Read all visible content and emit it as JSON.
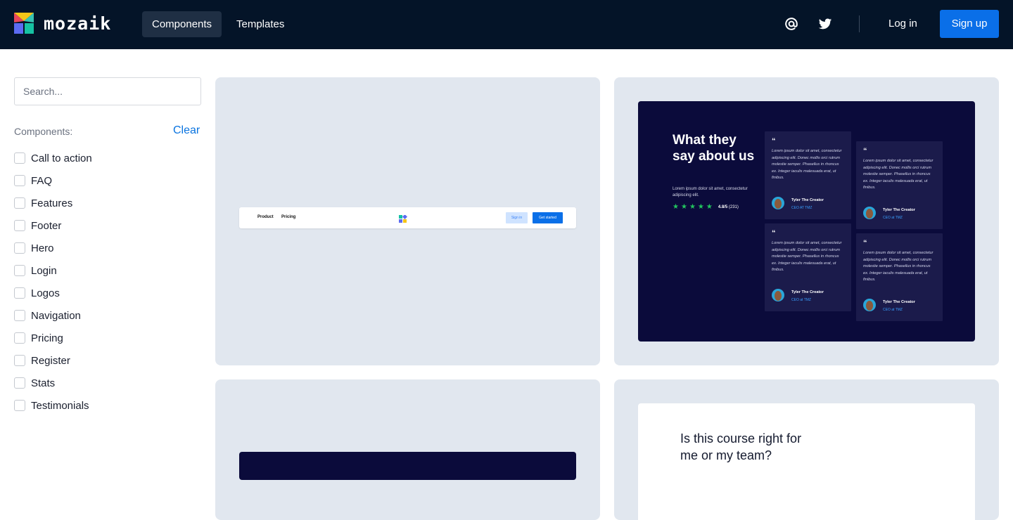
{
  "header": {
    "brand": "mozaik",
    "nav": [
      "Components",
      "Templates"
    ],
    "login": "Log in",
    "signup": "Sign up",
    "icons": [
      "at-icon",
      "twitter-icon"
    ]
  },
  "sidebar": {
    "search_placeholder": "Search...",
    "title": "Components:",
    "clear": "Clear",
    "items": [
      "Call to action",
      "FAQ",
      "Features",
      "Footer",
      "Hero",
      "Login",
      "Logos",
      "Navigation",
      "Pricing",
      "Register",
      "Stats",
      "Testimonials"
    ]
  },
  "cards": {
    "nav_preview": {
      "links": [
        "Product",
        "Pricing"
      ],
      "sign_in": "Sign in",
      "get_started": "Get started"
    },
    "testimonials_preview": {
      "title": "What they say about us",
      "subtitle": "Lorem ipsum dolor sit amet, consectetur adipiscing elit.",
      "rating_value": "4.8/5",
      "rating_count": "(231)",
      "quote_mark": "“",
      "quote": "Lorem ipsum dolor sit amet, consectetur adipiscing elit. Donec mollis orci rutrum molestie semper. Phasellus in rhoncus ex. Integer iaculis malesuada erat, ut finibus.",
      "author": "Tyler The Creator",
      "role_upper": "CEO AT TMZ",
      "role": "CEO at TMZ"
    },
    "faq_preview": {
      "title": "Is this course right for me or my team?"
    }
  },
  "colors": {
    "topbar": "#041428",
    "accent": "#0a6fe8",
    "card_bg": "#e1e7ef",
    "testimonial_bg": "#0b0b3b"
  }
}
